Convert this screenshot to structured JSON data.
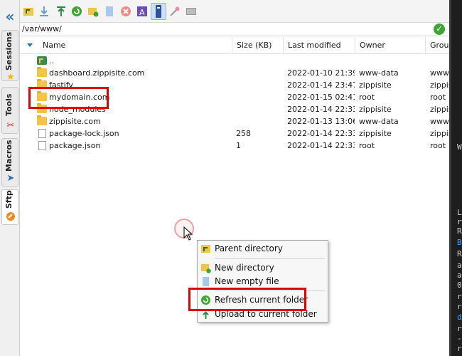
{
  "sidebar": {
    "collapse_glyph": "«",
    "tabs": [
      {
        "label": "Sessions",
        "icon": "star-icon"
      },
      {
        "label": "Tools",
        "icon": "tools-icon"
      },
      {
        "label": "Macros",
        "icon": "macros-icon"
      },
      {
        "label": "Sftp",
        "icon": "sftp-icon"
      }
    ],
    "active_tab": "Sftp"
  },
  "toolbar": {
    "buttons": [
      "parent-directory",
      "download",
      "upload",
      "refresh",
      "new-directory",
      "new-file",
      "delete",
      "rename",
      "text-mode",
      "settings",
      "terminal"
    ]
  },
  "path": {
    "value": "/var/www/"
  },
  "columns": {
    "name": "Name",
    "size": "Size (KB)",
    "modified": "Last modified",
    "owner": "Owner",
    "group": "Group"
  },
  "files": [
    {
      "name": "..",
      "type": "up",
      "size": "",
      "modified": "",
      "owner": "",
      "group": ""
    },
    {
      "name": "dashboard.zippisite.com",
      "type": "folder",
      "size": "",
      "modified": "2022-01-10 21:39",
      "owner": "www-data",
      "group": "www"
    },
    {
      "name": "fastify",
      "type": "folder",
      "size": "",
      "modified": "2022-01-14 23:47",
      "owner": "zippisite",
      "group": "zippis"
    },
    {
      "name": "mydomain.com",
      "type": "folder",
      "size": "",
      "modified": "2022-01-15 02:41",
      "owner": "root",
      "group": "root"
    },
    {
      "name": "node_modules",
      "type": "folder",
      "size": "",
      "modified": "2022-01-14 22:33",
      "owner": "zippisite",
      "group": "zippis"
    },
    {
      "name": "zippisite.com",
      "type": "folder",
      "size": "",
      "modified": "2022-01-13 13:06",
      "owner": "www-data",
      "group": "www"
    },
    {
      "name": "package-lock.json",
      "type": "file",
      "size": "258",
      "modified": "2022-01-14 22:33",
      "owner": "zippisite",
      "group": "zippis"
    },
    {
      "name": "package.json",
      "type": "file",
      "size": "1",
      "modified": "2022-01-14 22:33",
      "owner": "root",
      "group": "root"
    }
  ],
  "context_menu": {
    "items": [
      {
        "label": "Parent directory",
        "icon": "parent-directory-icon"
      },
      {
        "label": "New directory",
        "icon": "new-directory-icon"
      },
      {
        "label": "New empty file",
        "icon": "new-file-icon"
      },
      {
        "label": "Refresh current folder",
        "icon": "refresh-icon"
      },
      {
        "label": "Upload to current folder",
        "icon": "upload-icon"
      }
    ]
  },
  "terminal": {
    "lines": [
      "W",
      "L",
      "r",
      "R",
      "B",
      "R",
      "a",
      "a",
      "0",
      "r",
      "r",
      "d",
      "r",
      "-",
      "r"
    ]
  },
  "colors": {
    "highlight": "#e00000",
    "folder": "#f3c34a",
    "accent": "#2b6fb8",
    "terminal_bg": "#1e1e1e"
  }
}
